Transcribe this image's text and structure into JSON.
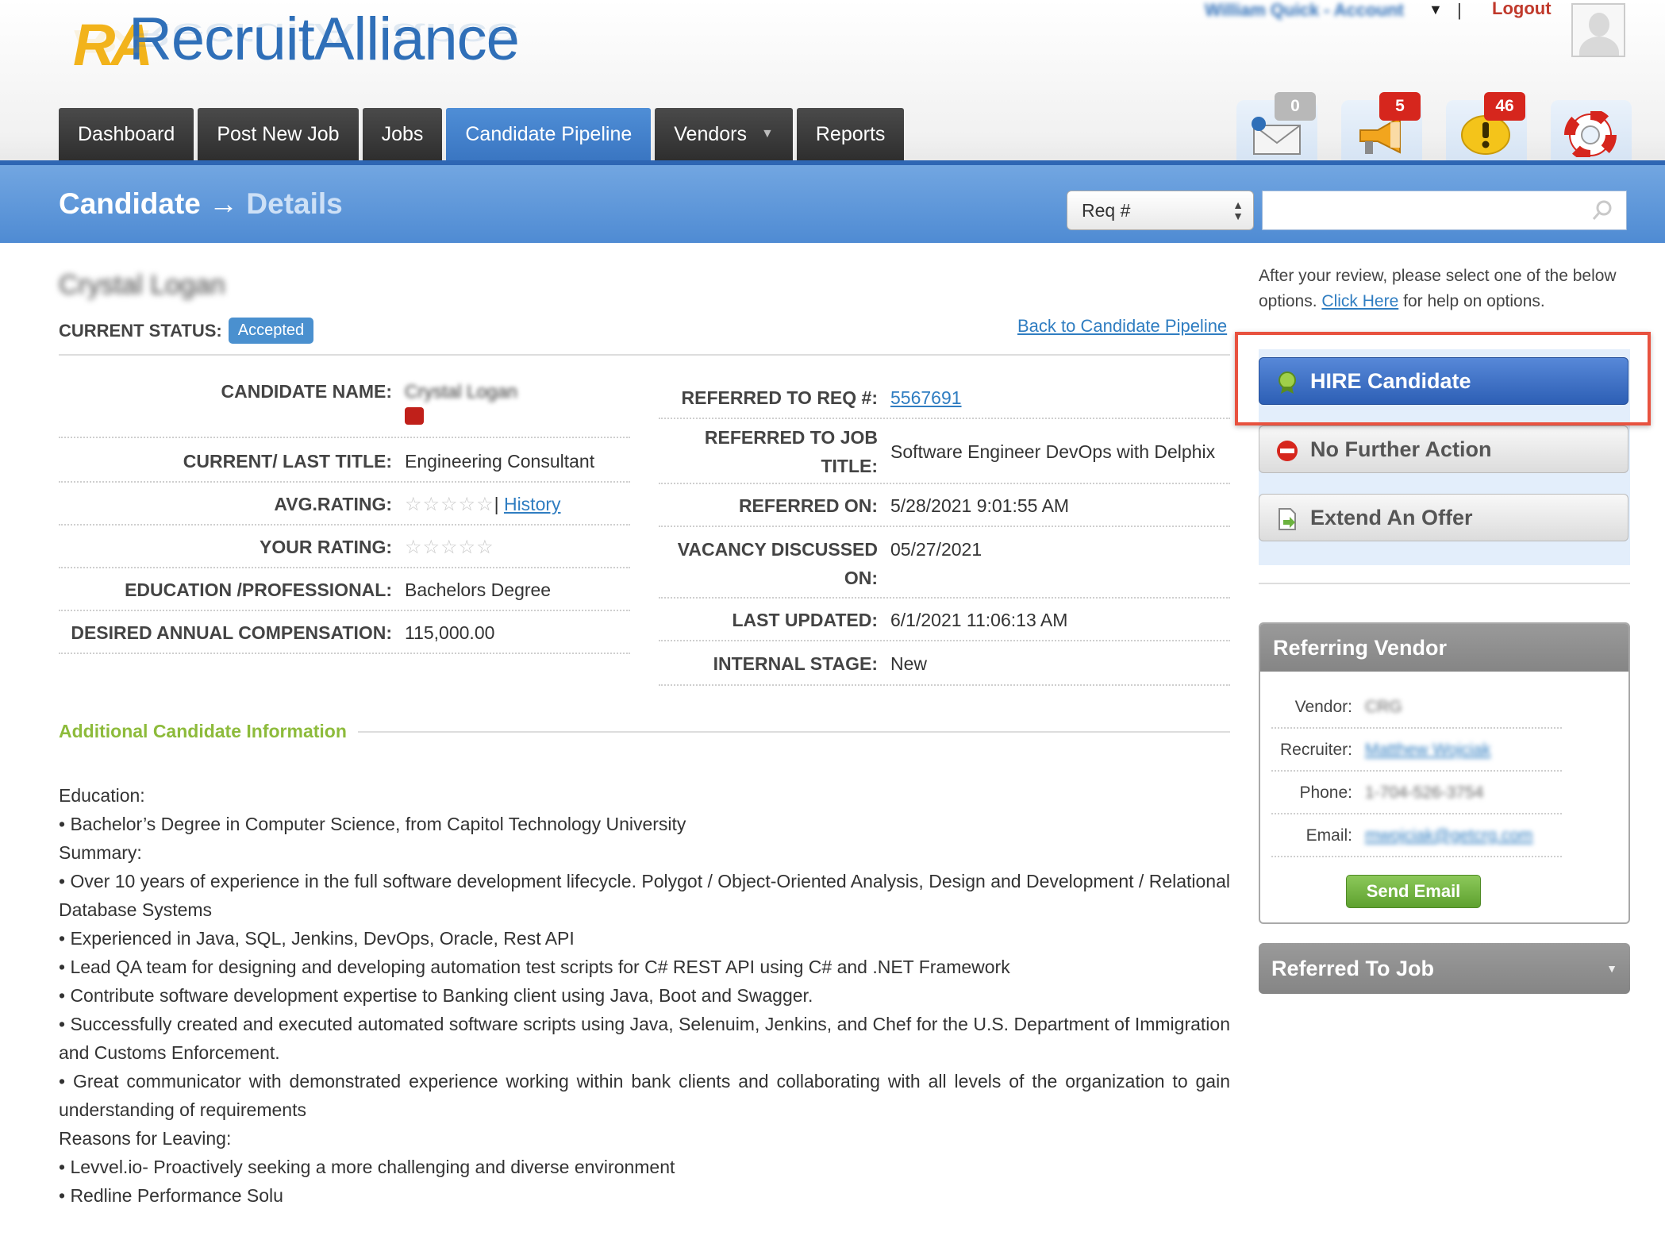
{
  "header": {
    "logo_mark": "RA",
    "logo_text": "RecruitAlliance",
    "account_link": "William Quick - Account",
    "account_separator": "|",
    "logout": "Logout"
  },
  "nav": {
    "tabs": [
      {
        "label": "Dashboard",
        "active": false
      },
      {
        "label": "Post New Job",
        "active": false
      },
      {
        "label": "Jobs",
        "active": false
      },
      {
        "label": "Candidate Pipeline",
        "active": true
      },
      {
        "label": "Vendors",
        "active": false,
        "dropdown": true
      },
      {
        "label": "Reports",
        "active": false
      }
    ]
  },
  "notifications": {
    "messages": {
      "icon": "envelope-icon",
      "count": "0"
    },
    "announcements": {
      "icon": "megaphone-icon",
      "count": "5"
    },
    "alerts": {
      "icon": "alert-icon",
      "count": "46"
    },
    "help": {
      "icon": "lifebuoy-icon"
    }
  },
  "titlebar": {
    "title_main": "Candidate",
    "arrow": "→",
    "title_sub": "Details",
    "search_select_value": "Req #",
    "search_placeholder": ""
  },
  "candidate": {
    "name_heading": "Crystal Logan",
    "status_label": "CURRENT STATUS:",
    "status_value": "Accepted",
    "back_link": "Back to Candidate Pipeline",
    "left_fields": {
      "name_label": "CANDIDATE NAME:",
      "name_value": "Crystal Logan",
      "title_label": "CURRENT/ LAST TITLE:",
      "title_value": "Engineering Consultant",
      "avg_rating_label": "AVG.RATING:",
      "avg_rating_stars": "☆☆☆☆☆",
      "avg_rating_sep": "|",
      "history_link": "History",
      "your_rating_label": "YOUR RATING:",
      "your_rating_stars": "☆☆☆☆☆",
      "education_label": "EDUCATION /PROFESSIONAL:",
      "education_value": "Bachelors Degree",
      "comp_label": "DESIRED ANNUAL COMPENSATION:",
      "comp_value": "115,000.00"
    },
    "right_fields": {
      "req_label": "REFERRED TO REQ #:",
      "req_value": "5567691",
      "job_title_label": "REFERRED TO JOB TITLE:",
      "job_title_value": "Software Engineer DevOps with Delphix",
      "referred_on_label": "REFERRED ON:",
      "referred_on_value": "5/28/2021 9:01:55 AM",
      "vacancy_label": "VACANCY DISCUSSED ON:",
      "vacancy_value": "05/27/2021",
      "updated_label": "LAST UPDATED:",
      "updated_value": "6/1/2021 11:06:13 AM",
      "stage_label": "INTERNAL STAGE:",
      "stage_value": "New"
    }
  },
  "additional": {
    "heading": "Additional Candidate Information",
    "lines": [
      "Education:",
      "• Bachelor’s Degree in Computer Science, from Capitol Technology University",
      "Summary:",
      "• Over 10 years of experience in the full software development lifecycle. Polygot / Object-Oriented Analysis, Design and Development / Relational Database Systems",
      "• Experienced in Java, SQL, Jenkins, DevOps, Oracle, Rest API",
      "• Lead QA team for designing and developing automation test scripts for C# REST API using C# and .NET Framework",
      "• Contribute software development expertise to Banking client using Java, Boot and Swagger.",
      "• Successfully created and executed automated software scripts using Java, Selenuim, Jenkins, and Chef for the U.S. Department of Immigration and Customs Enforcement.",
      "• Great communicator with demonstrated experience working within bank clients and collaborating with all levels of the organization to gain understanding of requirements",
      "Reasons for Leaving:",
      "• Levvel.io- Proactively seeking a more challenging and diverse environment",
      "• Redline Performance Solu"
    ]
  },
  "actions": {
    "help_text_before": "After your review, please select one of the below options.",
    "help_link": "Click Here",
    "help_text_after": "for help on options.",
    "hire": "HIRE Candidate",
    "no_further": "No Further Action",
    "extend_offer": "Extend An Offer"
  },
  "vendor": {
    "heading": "Referring Vendor",
    "vendor_label": "Vendor:",
    "vendor_value": "CRG",
    "recruiter_label": "Recruiter:",
    "recruiter_value": "Matthew Wojciak",
    "phone_label": "Phone:",
    "phone_value": "1-704-526-3754",
    "email_label": "Email:",
    "email_value": "mwojciak@getcrg.com",
    "send_email": "Send Email"
  },
  "referred_job": {
    "heading": "Referred To Job"
  },
  "colors": {
    "brand_blue": "#2f6fb8",
    "active_tab": "#3a76c2",
    "accent_green": "#8dbb3b",
    "status_badge": "#4a90cf",
    "highlight": "#e8523f"
  }
}
